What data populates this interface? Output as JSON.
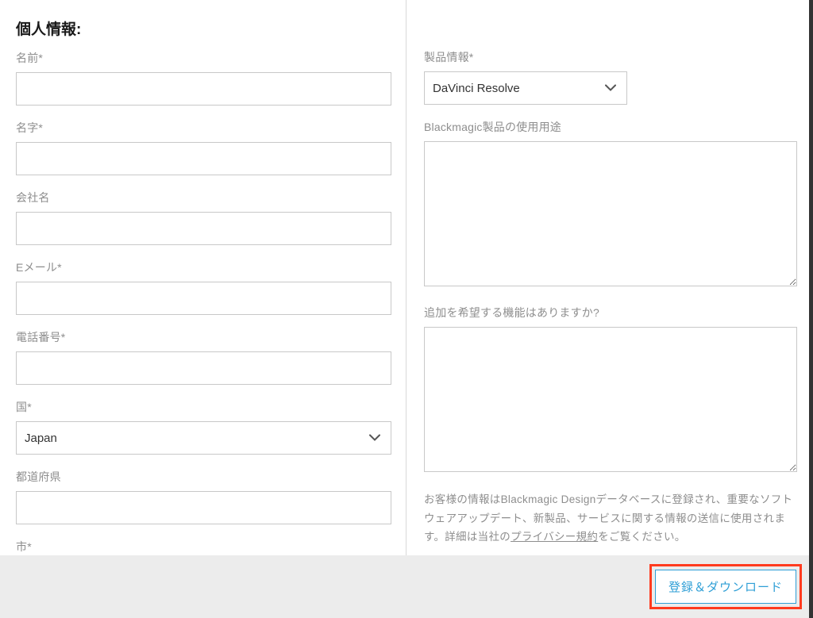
{
  "left": {
    "title": "個人情報:",
    "firstName": {
      "label": "名前*",
      "value": ""
    },
    "lastName": {
      "label": "名字*",
      "value": ""
    },
    "company": {
      "label": "会社名",
      "value": ""
    },
    "email": {
      "label": "Eメール*",
      "value": ""
    },
    "phone": {
      "label": "電話番号*",
      "value": ""
    },
    "country": {
      "label": "国*",
      "value": "Japan"
    },
    "prefecture": {
      "label": "都道府県",
      "value": ""
    },
    "city": {
      "label": "市*",
      "value": ""
    }
  },
  "right": {
    "product": {
      "label": "製品情報*",
      "value": "DaVinci Resolve"
    },
    "usage": {
      "label": "Blackmagic製品の使用用途",
      "value": ""
    },
    "features": {
      "label": "追加を希望する機能はありますか?",
      "value": ""
    },
    "disclaimer_pre": "お客様の情報はBlackmagic Designデータベースに登録され、重要なソフトウェアアップデート、新製品、サービスに関する情報の送信に使用されます。詳細は当社の",
    "disclaimer_link": "プライバシー規約",
    "disclaimer_post": "をご覧ください。"
  },
  "footer": {
    "submit": "登録＆ダウンロード"
  }
}
